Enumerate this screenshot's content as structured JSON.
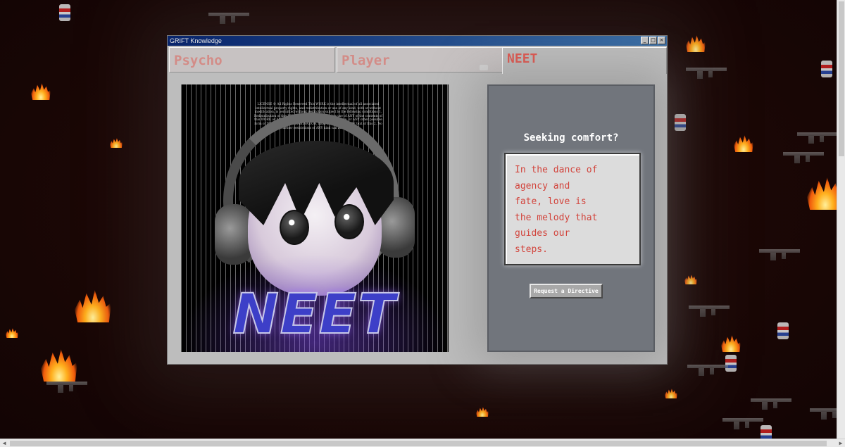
{
  "window": {
    "title": "GRIFT Knowledge",
    "controls": {
      "minimize": "_",
      "maximize": "□",
      "close": "×"
    }
  },
  "tabs": [
    {
      "label": "Psycho",
      "active": false
    },
    {
      "label": "Player",
      "active": false
    },
    {
      "label": "NEET",
      "active": true
    }
  ],
  "artwork": {
    "logo_text": "NEET",
    "license_text": "LICENSE © All Rights Reserved This WORK is the intellectual of all associated intellectual property rights, and redistribution or use of any kind, with or without modification, is permitted without restriction subject to the following conditions 1. Redistribution of this WORK or ANY work that makes use of ANY of the contents of this WORK or ANY derivative, copying, dependency, linkage, or ANY other possible form of DERIVATION or COMBINATION, must retain the ENTIRE text of this 2. No further restrictions of ANY kind can be applied."
  },
  "panel": {
    "title": "Seeking comfort?",
    "quote_lines": [
      "In the dance of",
      "agency and",
      "fate, love is",
      "the melody that",
      "guides our",
      "steps."
    ],
    "button_label": "Request a Directive"
  },
  "colors": {
    "accent_red": "#d2443c",
    "title_bar": "#08246b",
    "panel_bg": "#71757c",
    "logo_blue": "#3d3fc8"
  }
}
